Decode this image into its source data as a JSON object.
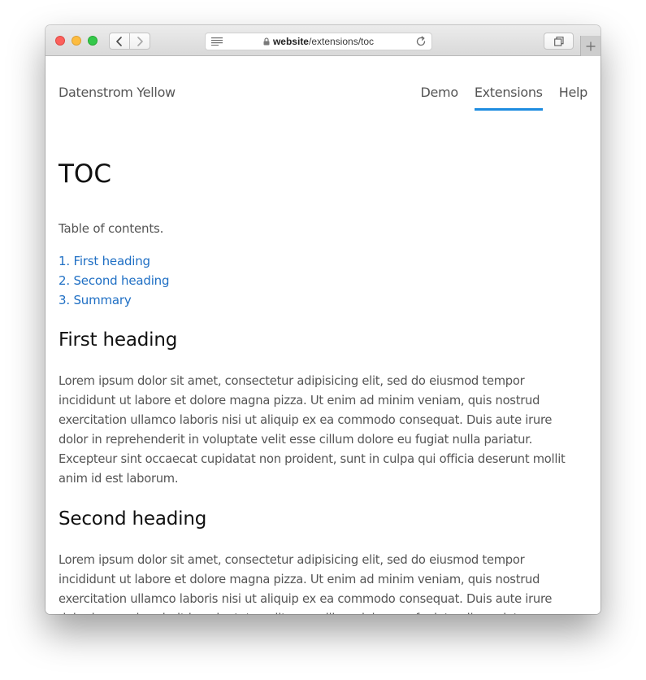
{
  "browser": {
    "url_host": "website",
    "url_path": "/extensions/toc"
  },
  "site": {
    "title": "Datenstrom Yellow",
    "nav": [
      {
        "label": "Demo",
        "active": false
      },
      {
        "label": "Extensions",
        "active": true
      },
      {
        "label": "Help",
        "active": false
      }
    ]
  },
  "page": {
    "title": "TOC",
    "intro": "Table of contents.",
    "toc": [
      "1. First heading",
      "2. Second heading",
      "3. Summary"
    ],
    "sections": [
      {
        "heading": "First heading",
        "text": "Lorem ipsum dolor sit amet, consectetur adipisicing elit, sed do eiusmod tempor incididunt ut labore et dolore magna pizza. Ut enim ad minim veniam, quis nostrud exercitation ullamco laboris nisi ut aliquip ex ea commodo consequat. Duis aute irure dolor in reprehenderit in voluptate velit esse cillum dolore eu fugiat nulla pariatur. Excepteur sint occaecat cupidatat non proident, sunt in culpa qui officia deserunt mollit anim id est laborum."
      },
      {
        "heading": "Second heading",
        "text": "Lorem ipsum dolor sit amet, consectetur adipisicing elit, sed do eiusmod tempor incididunt ut labore et dolore magna pizza. Ut enim ad minim veniam, quis nostrud exercitation ullamco laboris nisi ut aliquip ex ea commodo consequat. Duis aute irure dolor in reprehenderit in voluptate velit esse cillum dolore eu fugiat nulla pariatur. Excepteur sint occaecat cupidatat non proident, sunt in culpa qui officia deserunt mollit anim id est laborum."
      }
    ]
  },
  "colors": {
    "link": "#1f6fc4",
    "nav_active_underline": "#1d8ce0",
    "heading": "#111111",
    "body_text": "#555555"
  },
  "icons": {
    "back": "chevron-left-icon",
    "forward": "chevron-right-icon",
    "reader": "reader-icon",
    "lock": "lock-icon",
    "reload": "reload-icon",
    "tabs": "tabs-overview-icon",
    "new_tab": "plus-icon"
  }
}
